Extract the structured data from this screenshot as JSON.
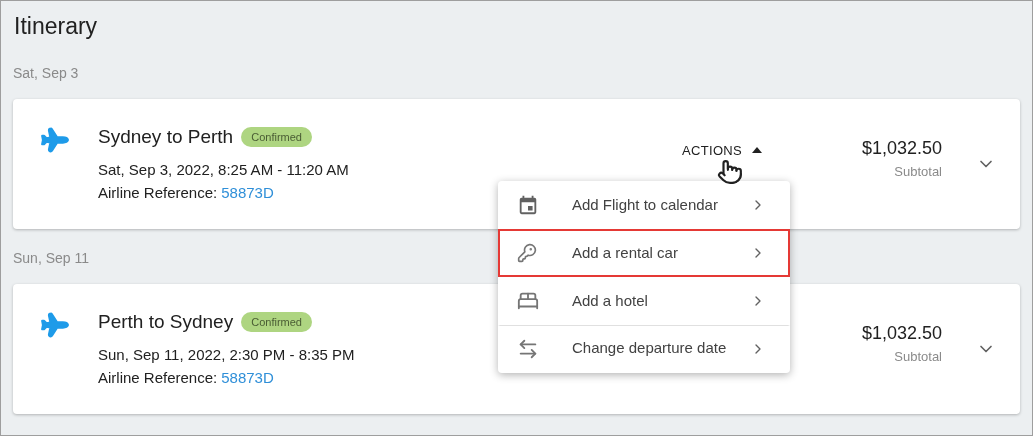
{
  "title": "Itinerary",
  "days": [
    {
      "date": "Sat, Sep 3",
      "trips": [
        {
          "route": "Sydney to Perth",
          "status": "Confirmed",
          "time": "Sat, Sep 3, 2022, 8:25 AM - 11:20 AM",
          "reference_label": "Airline Reference:",
          "reference": "58873D",
          "actions_label": "ACTIONS",
          "menu_open": true,
          "price": "$1,032.50",
          "price_label": "Subtotal"
        }
      ]
    },
    {
      "date": "Sun, Sep 11",
      "trips": [
        {
          "route": "Perth to Sydney",
          "status": "Confirmed",
          "time": "Sun, Sep 11, 2022, 2:30 PM - 8:35 PM",
          "reference_label": "Airline Reference:",
          "reference": "58873D",
          "price": "$1,032.50",
          "price_label": "Subtotal"
        }
      ]
    }
  ],
  "menu": {
    "items": [
      {
        "kind": "calendar",
        "label": "Add Flight to calendar",
        "selected": false,
        "separated": false
      },
      {
        "kind": "car",
        "label": "Add a rental car",
        "selected": true,
        "separated": false
      },
      {
        "kind": "hotel",
        "label": "Add a hotel",
        "selected": false,
        "separated": false
      },
      {
        "kind": "swap",
        "label": "Change departure date",
        "selected": false,
        "separated": true
      }
    ]
  }
}
